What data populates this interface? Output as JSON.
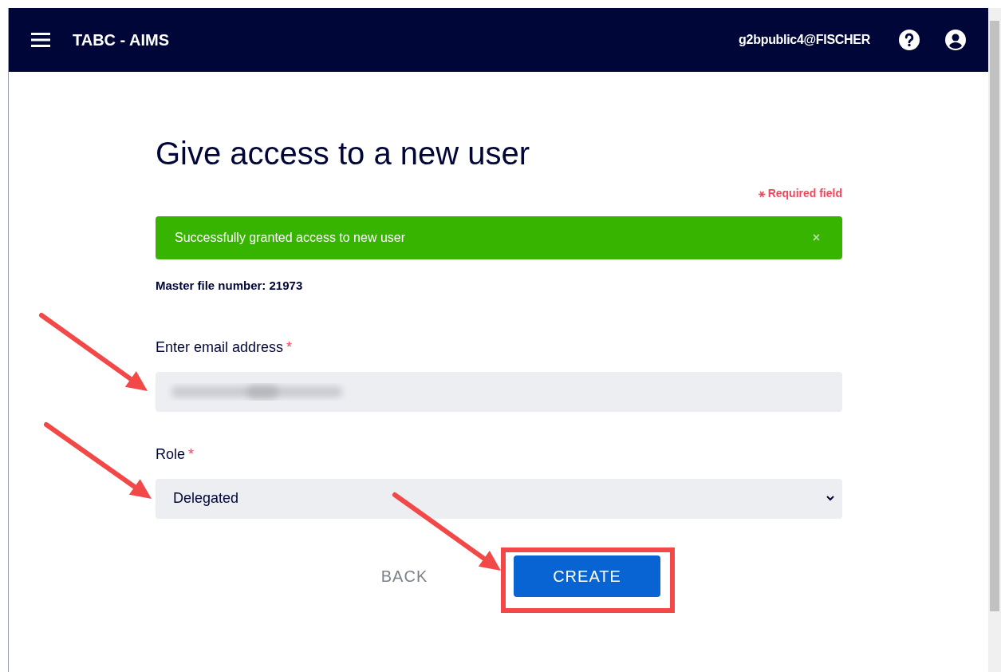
{
  "header": {
    "menu": true,
    "app_title": "TABC - AIMS",
    "user": "g2bpublic4@FISCHER"
  },
  "page": {
    "title": "Give access to a new user",
    "required_note": {
      "mark": "⚹",
      "text": "Required field"
    },
    "alert": {
      "kind": "success",
      "message": "Successfully granted access to new user",
      "close_label": "×"
    },
    "master_file": "Master file number: 21973",
    "fields": [
      {
        "kind": "text",
        "label": "Enter email address",
        "required_mark": "*",
        "value_blurred": true
      },
      {
        "kind": "select",
        "label": "Role",
        "required_mark": "*",
        "value": "Delegated"
      }
    ],
    "buttons": [
      {
        "label": "BACK",
        "kind": "text"
      },
      {
        "label": "CREATE",
        "kind": "primary"
      }
    ]
  },
  "annotations": [
    {
      "kind": "arrow"
    },
    {
      "kind": "arrow"
    },
    {
      "kind": "arrow"
    },
    {
      "kind": "highlight_box"
    }
  ]
}
